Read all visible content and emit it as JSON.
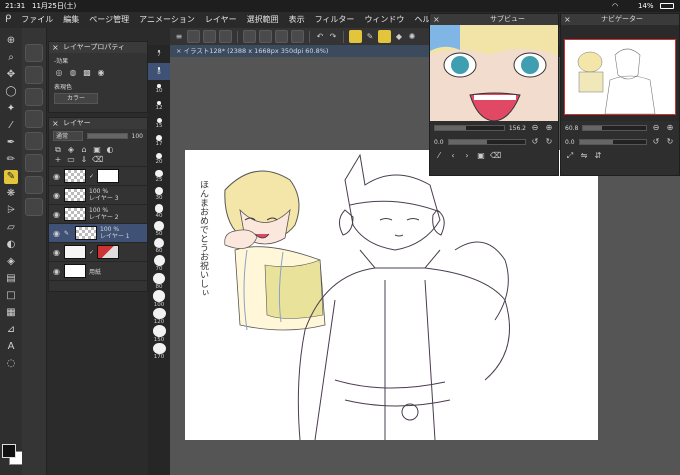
{
  "status": {
    "time": "21:31",
    "date": "11月25日(土)",
    "battery": "14%"
  },
  "menu": [
    "ファイル",
    "編集",
    "ページ管理",
    "アニメーション",
    "レイヤー",
    "選択範囲",
    "表示",
    "フィルター",
    "ウィンドウ",
    "ヘルプ"
  ],
  "doc_tab": "× イラスト128* (2388 x 1668px 350dpi 60.8%)",
  "layer_property": {
    "title": "レイヤープロパティ",
    "effect_label": "-効果",
    "expression_label": "表現色",
    "expression_value": "カラー"
  },
  "layer_panel": {
    "title": "レイヤー",
    "blend_mode": "通常",
    "opacity": "100",
    "layers": [
      {
        "opacity": "",
        "name": "",
        "selected": false
      },
      {
        "opacity": "100 %",
        "name": "レイヤー 3",
        "selected": false
      },
      {
        "opacity": "100 %",
        "name": "レイヤー 2",
        "selected": false
      },
      {
        "opacity": "100 %",
        "name": "レイヤー 1",
        "selected": true
      },
      {
        "opacity": "",
        "name": "",
        "selected": false
      },
      {
        "opacity": "",
        "name": "用紙",
        "selected": false
      }
    ]
  },
  "brush_sizes": [
    "7",
    "8",
    "10",
    "12",
    "15",
    "17",
    "20",
    "25",
    "30",
    "40",
    "50",
    "60",
    "70",
    "80",
    "100",
    "120",
    "150",
    "170"
  ],
  "sub_view": {
    "title": "サブビュー",
    "zoom": "156.2",
    "angle": "0.0"
  },
  "navigator": {
    "title": "ナビゲーター",
    "zoom": "60.8",
    "angle": "0.0"
  },
  "canvas_text": "ほんまおめでとうお祝いしぃ",
  "colors": {
    "accent": "#e3c53c",
    "selected_layer": "#3f5276",
    "tab": "#3c4a5e"
  }
}
